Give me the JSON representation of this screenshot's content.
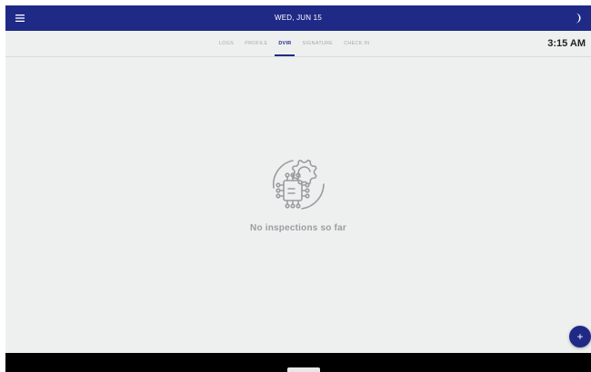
{
  "header": {
    "date": "WED, JUN 15",
    "menu_icon": "hamburger-menu-icon",
    "night_mode_icon": "moon-icon"
  },
  "tabs": [
    {
      "label": "LOGS",
      "active": false
    },
    {
      "label": "PROFILE",
      "active": false
    },
    {
      "label": "DVIR",
      "active": true
    },
    {
      "label": "SIGNATURE",
      "active": false
    },
    {
      "label": "CHECK IN",
      "active": false
    }
  ],
  "clock": {
    "time": "3:15 AM"
  },
  "empty_state": {
    "icon": "gear-chip-icon",
    "message": "No inspections so far"
  },
  "fab": {
    "label": "+",
    "icon": "plus-icon"
  },
  "colors": {
    "primary": "#1f2a86",
    "background": "#eef0f0",
    "muted_text": "#9a9da0",
    "inactive_tab": "#a5a8ab"
  }
}
